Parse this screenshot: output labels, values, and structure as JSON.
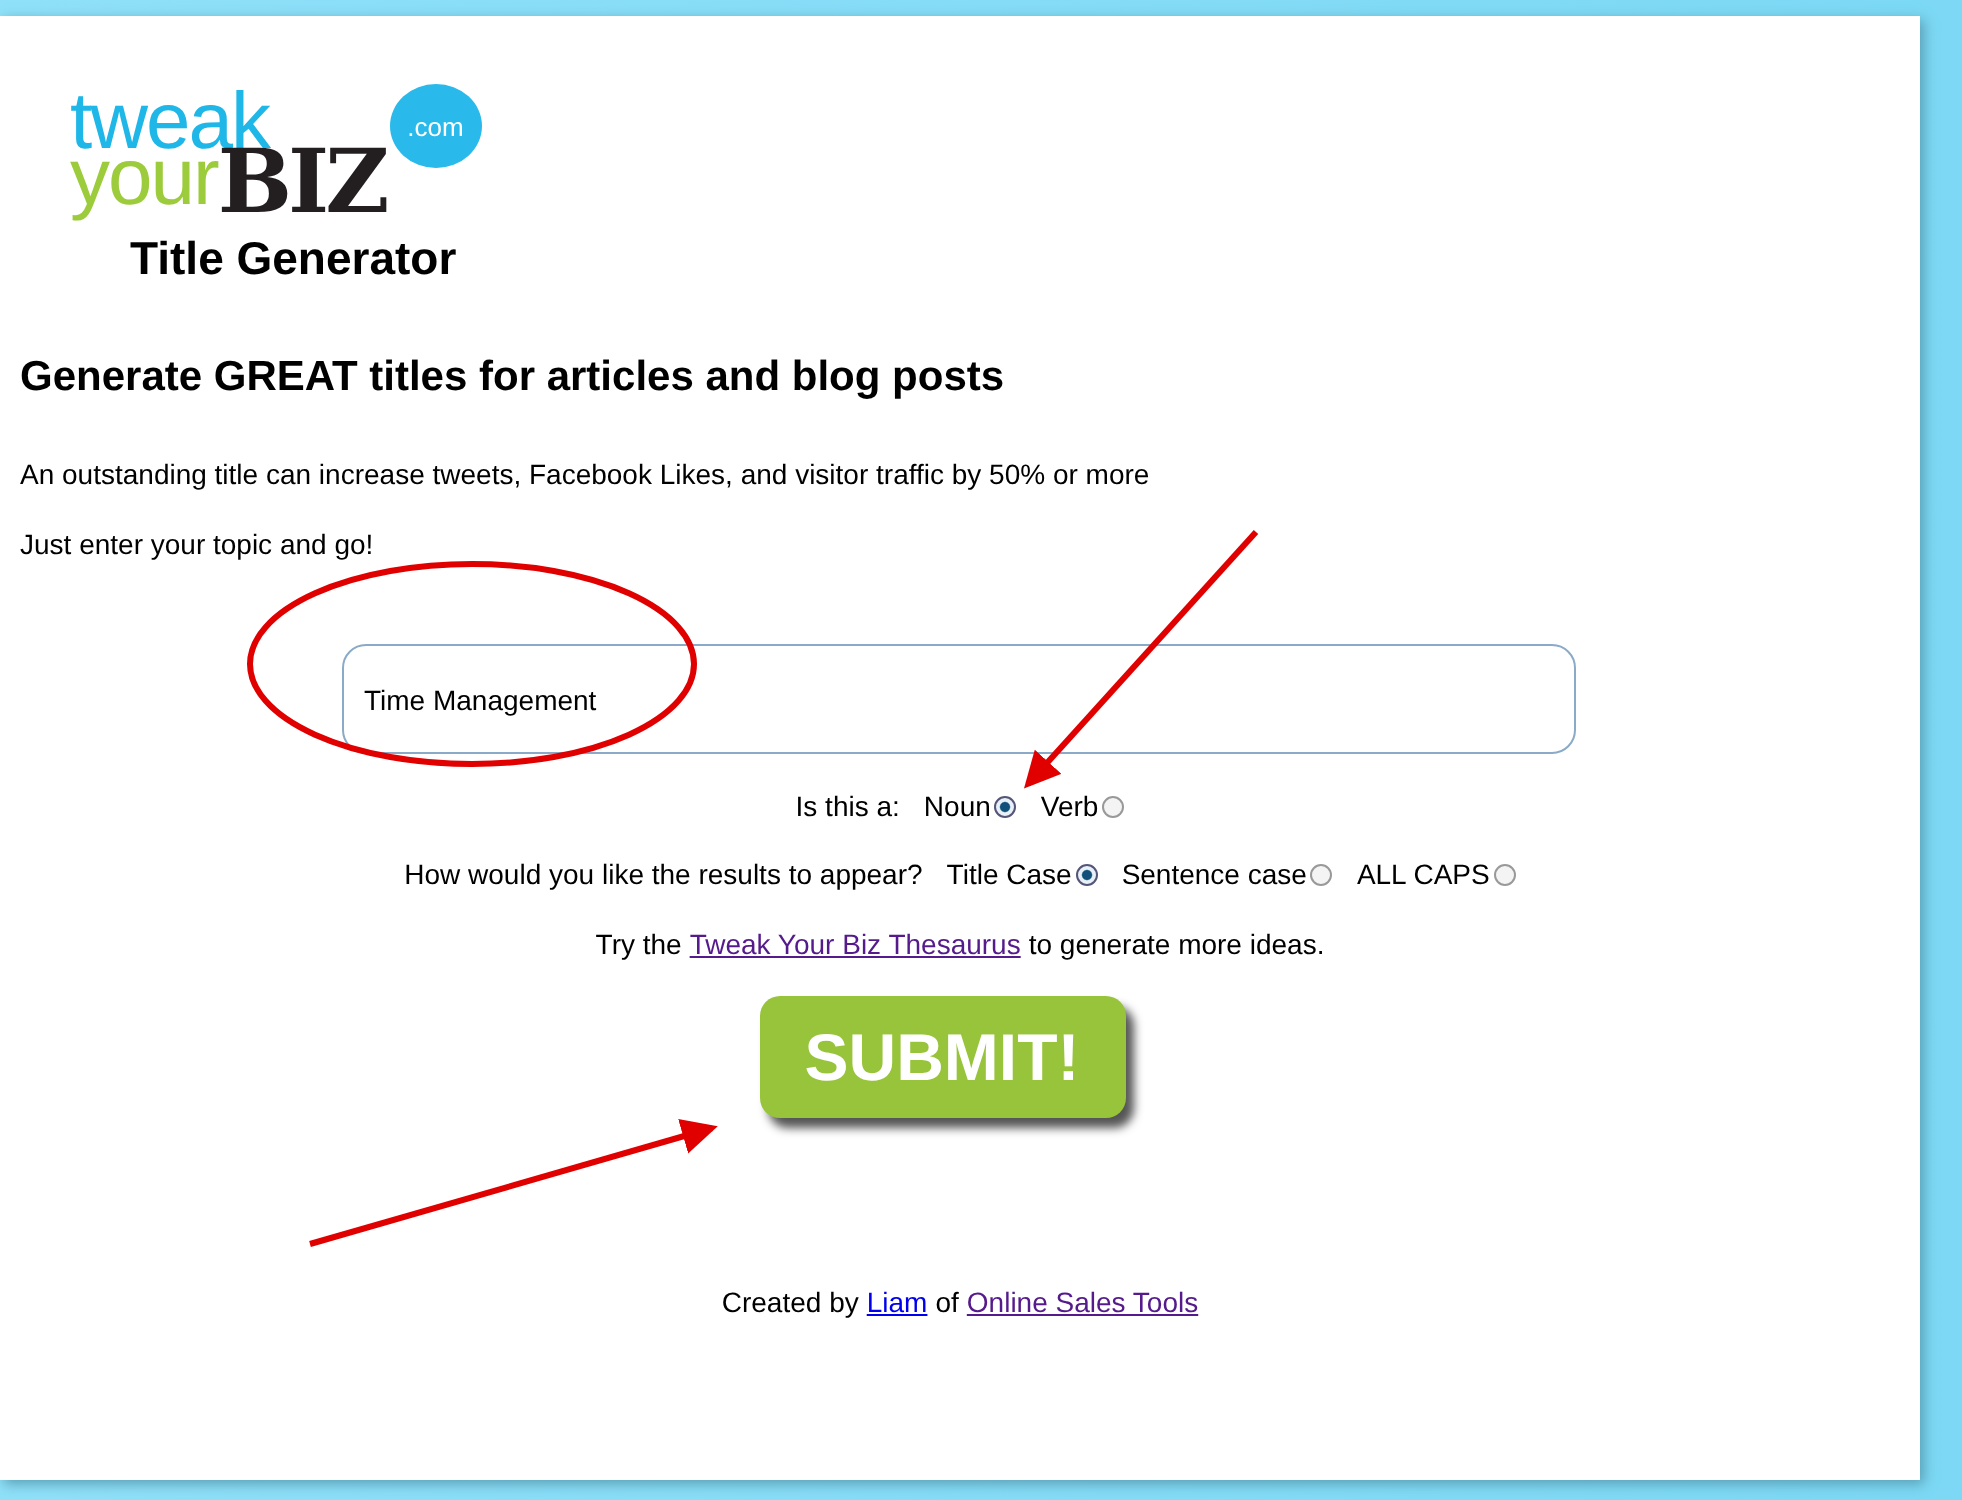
{
  "logo": {
    "line_1": "tweak",
    "line_2": "your",
    "brand": "BIZ",
    "domain": ".com",
    "subtitle": "Title Generator"
  },
  "heading": "Generate GREAT titles for articles and blog posts",
  "intro": [
    "An outstanding title can increase tweets, Facebook Likes, and visitor traffic by 50% or more",
    "Just enter your topic and go!"
  ],
  "topic_field": {
    "value": "Time Management"
  },
  "word_type": {
    "label": "Is this a:",
    "options": [
      {
        "label": "Noun",
        "selected": true
      },
      {
        "label": "Verb",
        "selected": false
      }
    ]
  },
  "case_style": {
    "label": "How would you like the results to appear?",
    "options": [
      {
        "label": "Title Case",
        "selected": true
      },
      {
        "label": "Sentence case",
        "selected": false
      },
      {
        "label": "ALL CAPS",
        "selected": false
      }
    ]
  },
  "thesaurus_note": {
    "before": "Try the",
    "link": "Tweak Your Biz Thesaurus",
    "after": "to generate more ideas."
  },
  "submit_button": "SUBMIT!",
  "footer": {
    "before": "Created by",
    "author": "Liam",
    "middle": "of",
    "company": "Online Sales Tools"
  }
}
